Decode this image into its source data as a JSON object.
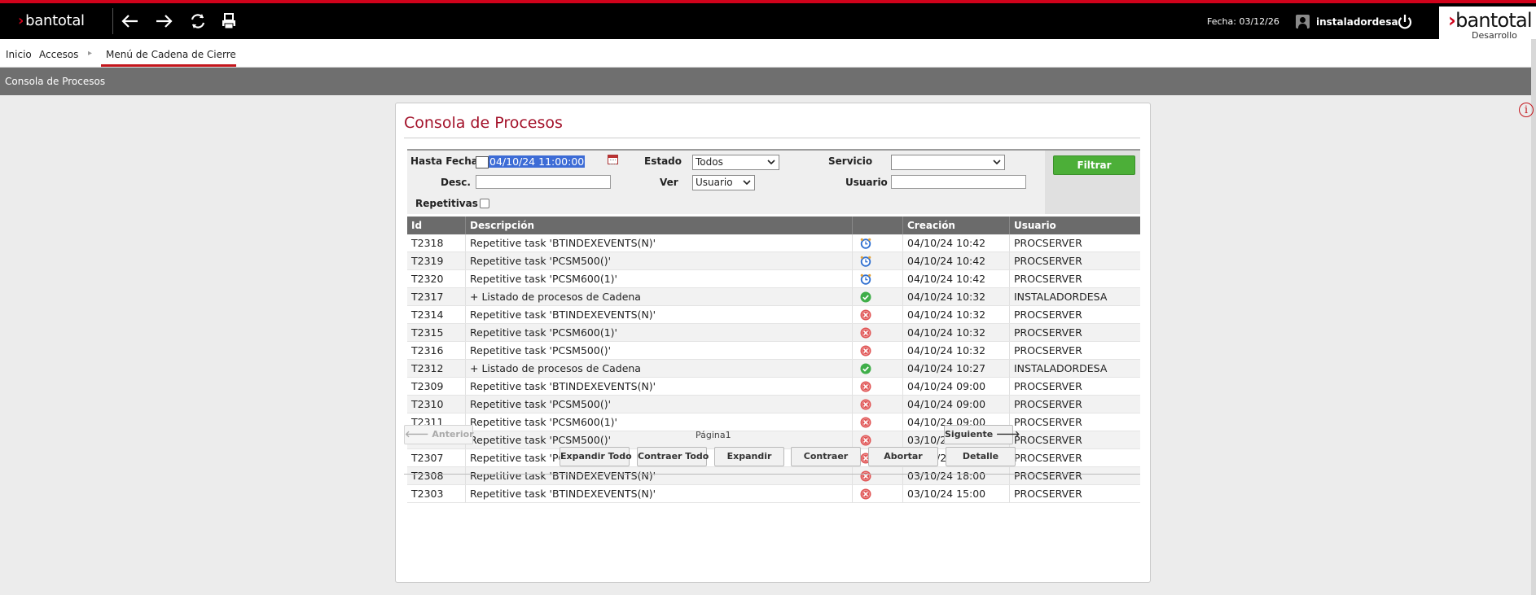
{
  "topbar": {
    "logo_text": "bantotal",
    "date_label": "Fecha: 03/12/26",
    "username": "instaladordesa",
    "brand_text": "bantotal",
    "environment": "Desarrollo",
    "accent_color": "#d0021b"
  },
  "breadcrumb": {
    "home": "Inicio",
    "level1": "Accesos",
    "current": "Menú de Cadena de Cierre"
  },
  "section": {
    "title": "Consola de Procesos"
  },
  "panel": {
    "title": "Consola de Procesos"
  },
  "filters": {
    "hasta_fecha_label": "Hasta Fecha",
    "hasta_fecha_value": "04/10/24 11:00:00",
    "estado_label": "Estado",
    "estado_value": "Todos",
    "servicio_label": "Servicio",
    "servicio_value": "",
    "desc_label": "Desc.",
    "desc_value": "",
    "ver_label": "Ver",
    "ver_value": "Usuario",
    "usuario_label": "Usuario",
    "usuario_value": "",
    "repetitivas_label": "Repetitivas",
    "repetitivas_checked": false,
    "filter_button": "Filtrar"
  },
  "table": {
    "columns": [
      "Id",
      "Descripción",
      "",
      "Creación",
      "Usuario"
    ],
    "rows": [
      {
        "id": "T2318",
        "desc": "Repetitive task 'BTINDEXEVENTS(N)'",
        "status": "scheduled",
        "created": "04/10/24 10:42",
        "user": "PROCSERVER"
      },
      {
        "id": "T2319",
        "desc": "Repetitive task 'PCSM500()'",
        "status": "scheduled",
        "created": "04/10/24 10:42",
        "user": "PROCSERVER"
      },
      {
        "id": "T2320",
        "desc": "Repetitive task 'PCSM600(1)'",
        "status": "scheduled",
        "created": "04/10/24 10:42",
        "user": "PROCSERVER"
      },
      {
        "id": "T2317",
        "desc": "+ Listado de procesos de Cadena",
        "status": "ok",
        "created": "04/10/24 10:32",
        "user": "INSTALADORDESA"
      },
      {
        "id": "T2314",
        "desc": "Repetitive task 'BTINDEXEVENTS(N)'",
        "status": "error",
        "created": "04/10/24 10:32",
        "user": "PROCSERVER"
      },
      {
        "id": "T2315",
        "desc": "Repetitive task 'PCSM600(1)'",
        "status": "error",
        "created": "04/10/24 10:32",
        "user": "PROCSERVER"
      },
      {
        "id": "T2316",
        "desc": "Repetitive task 'PCSM500()'",
        "status": "error",
        "created": "04/10/24 10:32",
        "user": "PROCSERVER"
      },
      {
        "id": "T2312",
        "desc": "+ Listado de procesos de Cadena",
        "status": "ok",
        "created": "04/10/24 10:27",
        "user": "INSTALADORDESA"
      },
      {
        "id": "T2309",
        "desc": "Repetitive task 'BTINDEXEVENTS(N)'",
        "status": "error",
        "created": "04/10/24 09:00",
        "user": "PROCSERVER"
      },
      {
        "id": "T2310",
        "desc": "Repetitive task 'PCSM500()'",
        "status": "error",
        "created": "04/10/24 09:00",
        "user": "PROCSERVER"
      },
      {
        "id": "T2311",
        "desc": "Repetitive task 'PCSM600(1)'",
        "status": "error",
        "created": "04/10/24 09:00",
        "user": "PROCSERVER"
      },
      {
        "id": "T2306",
        "desc": "Repetitive task 'PCSM500()'",
        "status": "error",
        "created": "03/10/24 18:00",
        "user": "PROCSERVER"
      },
      {
        "id": "T2307",
        "desc": "Repetitive task 'PCSM600(1)'",
        "status": "error",
        "created": "03/10/24 18:00",
        "user": "PROCSERVER"
      },
      {
        "id": "T2308",
        "desc": "Repetitive task 'BTINDEXEVENTS(N)'",
        "status": "error",
        "created": "03/10/24 18:00",
        "user": "PROCSERVER"
      },
      {
        "id": "T2303",
        "desc": "Repetitive task 'BTINDEXEVENTS(N)'",
        "status": "error",
        "created": "03/10/24 15:00",
        "user": "PROCSERVER"
      }
    ]
  },
  "pager": {
    "prev": "Anterior",
    "page": "Página1",
    "next": "Siguiente"
  },
  "actions": {
    "expand_all": "Expandir Todo",
    "collapse_all": "Contraer Todo",
    "expand": "Expandir",
    "collapse": "Contraer",
    "abort": "Abortar",
    "detail": "Detalle"
  }
}
